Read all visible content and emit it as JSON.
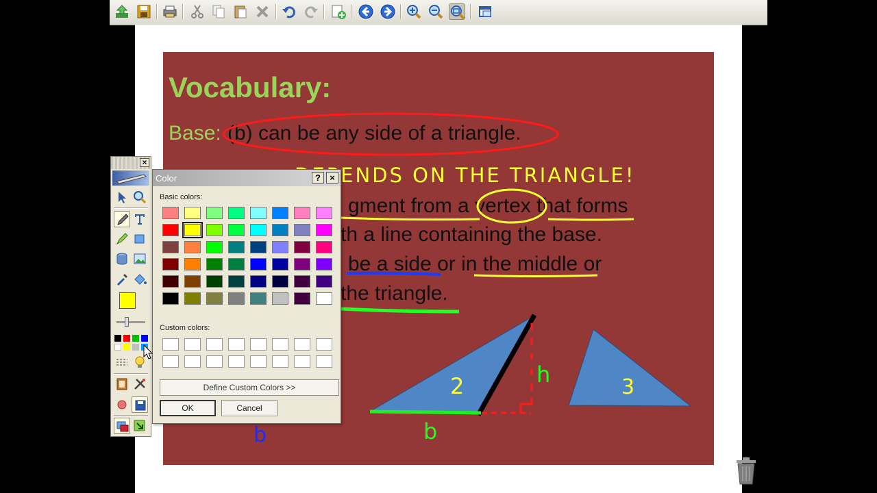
{
  "toolbar": {
    "buttons": [
      "back-up-icon",
      "save-icon",
      "print-icon",
      "cut-icon",
      "copy-icon",
      "paste-icon",
      "delete-icon",
      "undo-icon",
      "redo-icon",
      "add-page-icon",
      "previous-page-icon",
      "next-page-icon",
      "zoom-in-icon",
      "zoom-out-icon",
      "zoom-fit-icon",
      "window-icon"
    ]
  },
  "slide": {
    "title": "Vocabulary:",
    "base_label": "Base:",
    "base_definition": "(b) can be any side of a triangle.",
    "handwriting_depends": "DEPENDS ON THE TRIANGLE!",
    "line1_a": "gment from a ",
    "line1_b": "vertex",
    "line1_c": " that forms",
    "line2": "th a line containing the base.",
    "line3_a": "be a side",
    "line3_b": " or ",
    "line3_c": "in the middle",
    "line3_d": " or",
    "line4": "the triangle.",
    "triangle2_label": "2",
    "triangle3_label": "3",
    "height_label": "h",
    "base_label_b": "b",
    "base_label_b_blue": "b"
  },
  "dialog": {
    "title": "Color",
    "help": "?",
    "close": "×",
    "basic_colors_label": "Basic colors:",
    "custom_colors_label": "Custom colors:",
    "define_custom": "Define Custom Colors >>",
    "ok": "OK",
    "cancel": "Cancel",
    "selected_color": "#ffff00",
    "basic_colors": [
      [
        "#ff8080",
        "#ffff80",
        "#80ff80",
        "#00ff80",
        "#80ffff",
        "#0080ff",
        "#ff80c0",
        "#ff80ff"
      ],
      [
        "#ff0000",
        "#ffff00",
        "#80ff00",
        "#00ff40",
        "#00ffff",
        "#0080c0",
        "#8080c0",
        "#ff00ff"
      ],
      [
        "#804040",
        "#ff8040",
        "#00ff00",
        "#008080",
        "#004080",
        "#8080ff",
        "#800040",
        "#ff0080"
      ],
      [
        "#800000",
        "#ff8000",
        "#008000",
        "#008040",
        "#0000ff",
        "#0000a0",
        "#800080",
        "#8000ff"
      ],
      [
        "#400000",
        "#804000",
        "#004000",
        "#004040",
        "#000080",
        "#000040",
        "#400040",
        "#400080"
      ],
      [
        "#000000",
        "#808000",
        "#808040",
        "#808080",
        "#408080",
        "#c0c0c0",
        "#400040",
        "#ffffff"
      ]
    ]
  },
  "palette": {
    "close": "×",
    "current_color": "#ffff00",
    "mini_colors": [
      "#000000",
      "#ff0000",
      "#00c000",
      "#0000ff",
      "#ffffff",
      "#ffff00",
      "#c0c0c0",
      "#00a0ff"
    ]
  }
}
